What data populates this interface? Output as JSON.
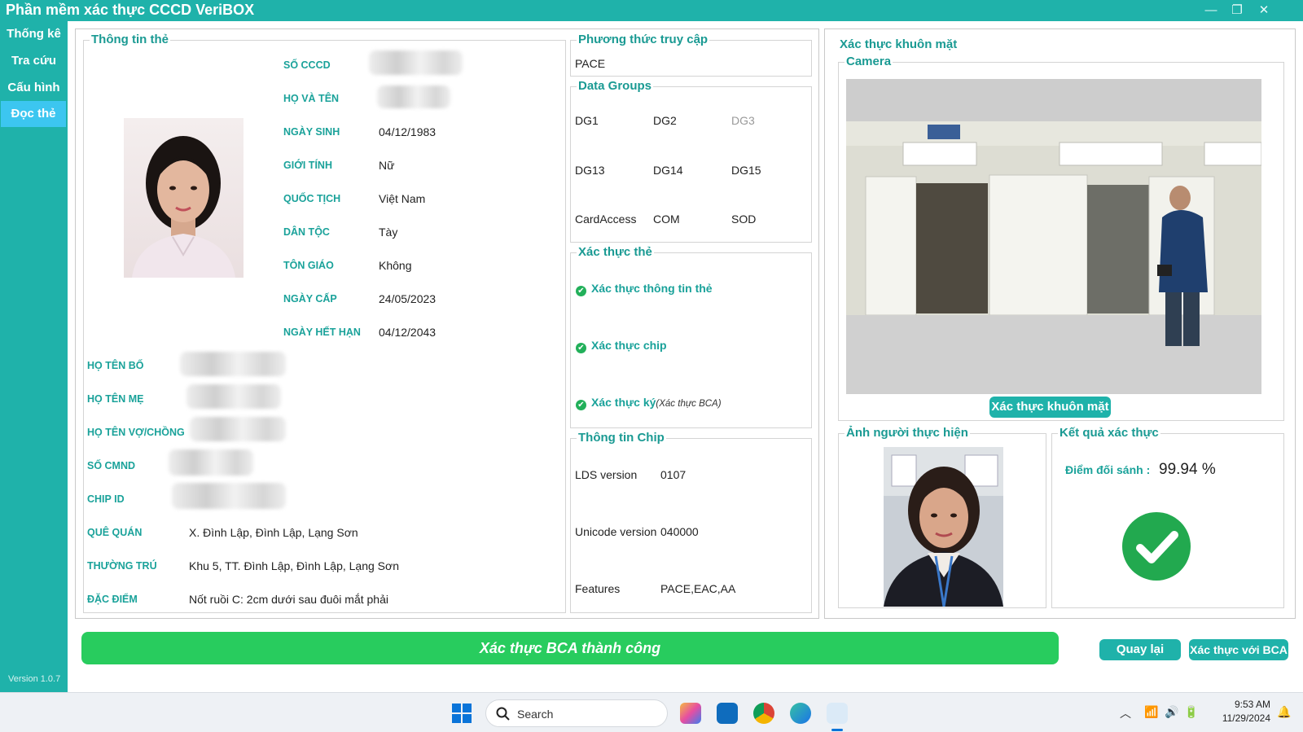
{
  "window": {
    "title": "Phần mềm xác thực CCCD VeriBOX",
    "minimize": "—",
    "restore": "❐",
    "close": "✕"
  },
  "sidebar": {
    "items": [
      {
        "label": "Thống kê"
      },
      {
        "label": "Tra cứu"
      },
      {
        "label": "Cấu hình"
      },
      {
        "label": "Đọc thẻ"
      }
    ],
    "active_index": 3,
    "version": "Version 1.0.7"
  },
  "card_info": {
    "title": "Thông tin thẻ",
    "labels": {
      "id_number": "SỐ CCCD",
      "full_name": "HỌ VÀ TÊN",
      "dob": "NGÀY SINH",
      "gender": "GIỚI TÍNH",
      "nationality": "QUỐC TỊCH",
      "ethnicity": "DÂN TỘC",
      "religion": "TÔN GIÁO",
      "issue_date": "NGÀY CẤP",
      "expiry_date": "NGÀY HẾT HẠN",
      "father": "HỌ TÊN BỐ",
      "mother": "HỌ TÊN MẸ",
      "spouse": "HỌ TÊN VỢ/CHỒNG",
      "old_id": "SỐ CMND",
      "chip_id": "CHIP ID",
      "hometown": "QUÊ QUÁN",
      "residence": "THƯỜNG TRÚ",
      "features": "ĐẶC ĐIỂM"
    },
    "values": {
      "dob": "04/12/1983",
      "gender": "Nữ",
      "nationality": "Việt Nam",
      "ethnicity": "Tày",
      "religion": "Không",
      "issue_date": "24/05/2023",
      "expiry_date": "04/12/2043",
      "hometown": "X. Đình Lập, Đình Lập, Lạng Sơn",
      "residence": "Khu 5, TT. Đình Lập, Đình Lập, Lạng Sơn",
      "features": "Nốt ruồi C: 2cm dưới sau đuôi mắt phải"
    }
  },
  "access": {
    "title": "Phương thức truy cập",
    "value": "PACE"
  },
  "data_groups": {
    "title": "Data Groups",
    "rows": [
      [
        {
          "label": "DG1",
          "enabled": true
        },
        {
          "label": "DG2",
          "enabled": true
        },
        {
          "label": "DG3",
          "enabled": false
        }
      ],
      [
        {
          "label": "DG13",
          "enabled": true
        },
        {
          "label": "DG14",
          "enabled": true
        },
        {
          "label": "DG15",
          "enabled": true
        }
      ],
      [
        {
          "label": "CardAccess",
          "enabled": true
        },
        {
          "label": "COM",
          "enabled": true
        },
        {
          "label": "SOD",
          "enabled": true
        }
      ]
    ]
  },
  "card_verify": {
    "title": "Xác thực thẻ",
    "items": [
      {
        "label": "Xác thực thông tin thẻ",
        "note": ""
      },
      {
        "label": "Xác thực chip",
        "note": ""
      },
      {
        "label": "Xác thực ký",
        "note": "(Xác thực BCA)"
      }
    ]
  },
  "chip_info": {
    "title": "Thông tin Chip",
    "rows": [
      {
        "label": "LDS version",
        "value": "0107"
      },
      {
        "label": "Unicode version",
        "value": "040000"
      },
      {
        "label": "Features",
        "value": "PACE,EAC,AA"
      }
    ]
  },
  "face": {
    "title": "Xác thực khuôn mặt",
    "camera_title": "Camera",
    "verify_button": "Xác thực khuôn mặt",
    "person_title": "Ảnh người thực hiện",
    "result_title": "Kết quả xác thực",
    "score_label": "Điểm đối sánh :",
    "score_value": "99.94 %"
  },
  "bottom": {
    "status": "Xác thực BCA thành công",
    "back_button": "Quay lại",
    "bca_button": "Xác thực với BCA"
  },
  "taskbar": {
    "search_placeholder": "Search",
    "time": "9:53 AM",
    "date": "11/29/2024"
  },
  "colors": {
    "accent": "#1fb2aa",
    "active_nav": "#3cc6f0",
    "success": "#28cc5e",
    "check": "#22b05a"
  }
}
